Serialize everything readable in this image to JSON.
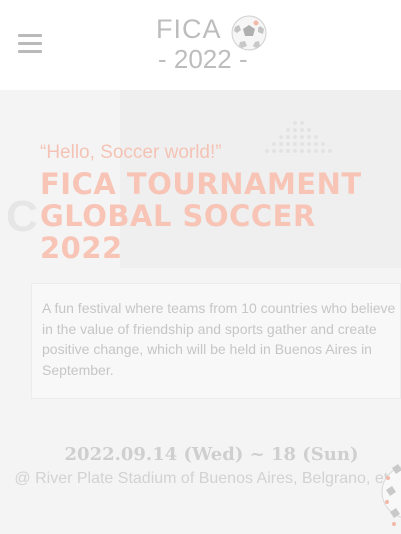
{
  "header": {
    "logo_title": "FICA",
    "logo_year": "- 2022 -"
  },
  "hero": {
    "greeting": "“Hello, Soccer world!”",
    "title_lines": [
      "FICA TOURNAMENT",
      "GLOBAL SOCCER",
      "2022"
    ],
    "background_letter": "C",
    "description": "A fun festival where teams from 10 countries who believe in the value of friendship and sports gather and create positive change, which will be held in Buenos Aires in September.",
    "date": "2022.09.14 (Wed) ~ 18 (Sun)",
    "venue": "@ River Plate Stadium of Buenos Aires, Belgrano, etc."
  },
  "colors": {
    "accent": "#f7c4b6",
    "muted_text": "#c6c6c6",
    "background": "#f4f4f4"
  },
  "icons": {
    "menu": "hamburger-icon",
    "logo_ball": "soccer-ball-icon"
  }
}
